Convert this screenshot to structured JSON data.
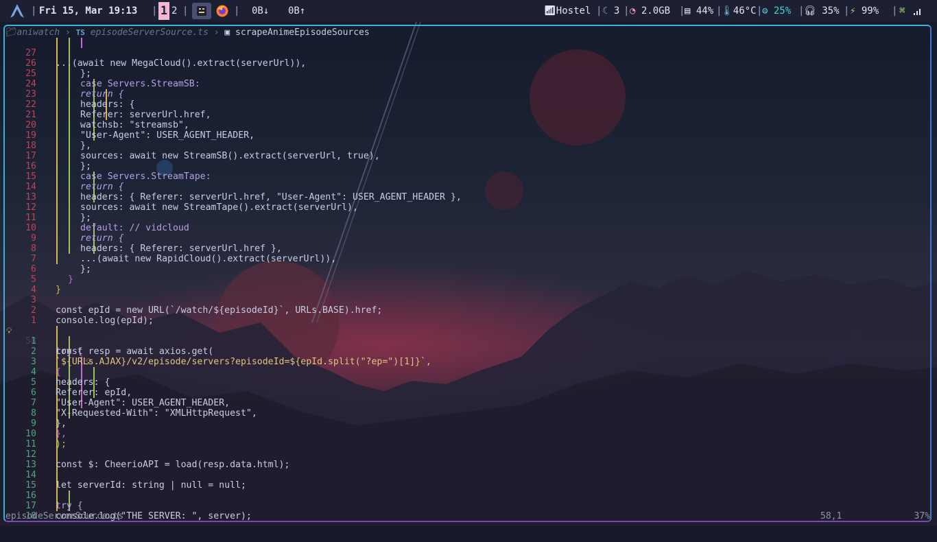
{
  "topbar": {
    "launcher_icon": "arch-logo-icon",
    "datetime": "Fri 15, Mar 19:13",
    "workspaces": [
      "1",
      "2"
    ],
    "active_workspace": "1",
    "apps": [
      "terminal-icon",
      "firefox-icon"
    ],
    "net_down": "0B↓",
    "net_up": "0B↑",
    "wifi_name": "Hostel",
    "moon_count": "3",
    "memory": "2.0GB",
    "disk": "44%",
    "temperature": "46°C",
    "cpu": "25%",
    "volume": "35%",
    "battery": "99%"
  },
  "editor": {
    "breadcrumb": {
      "folder": "aniwatch",
      "file_icon": "TS",
      "file": "episodeServerSource.ts",
      "symbol": "scrapeAnimeEpisodeSources"
    },
    "status": {
      "filename": "episodeServerSource.ts",
      "position": "58,1",
      "percent": "37%"
    },
    "line_numbers": [
      "27",
      "26",
      "25",
      "24",
      "23",
      "22",
      "21",
      "20",
      "19",
      "18",
      "17",
      "16",
      "15",
      "14",
      "13",
      "12",
      "11",
      "10",
      "9",
      "8",
      "7",
      "6",
      "5",
      "4",
      "3",
      "2",
      "1",
      "58",
      "1",
      "2",
      "3",
      "4",
      "5",
      "6",
      "7",
      "8",
      "9",
      "10",
      "11",
      "12",
      "13",
      "14",
      "15",
      "16",
      "17",
      "18"
    ],
    "code_lines": [
      "    ...(await new MegaCloud().extract(serverUrl)),",
      "  };",
      "case Servers.StreamSB:",
      "  return {",
      "    headers: {",
      "      Referer: serverUrl.href,",
      "      watchsb: \"streamsb\",",
      "      \"User-Agent\": USER_AGENT_HEADER,",
      "    },",
      "    sources: await new StreamSB().extract(serverUrl, true),",
      "  };",
      "case Servers.StreamTape:",
      "  return {",
      "    headers: { Referer: serverUrl.href, \"User-Agent\": USER_AGENT_HEADER },",
      "    sources: await new StreamTape().extract(serverUrl),",
      "  };",
      "default: // vidcloud",
      "  return {",
      "    headers: { Referer: serverUrl.href },",
      "    ...(await new RapidCloud().extract(serverUrl)),",
      "  };",
      "}",
      "}",
      "",
      "const epId = new URL(`/watch/${episodeId}`, URLs.BASE).href;",
      "console.log(epId);",
      "",
      "try {",
      "  const resp = await axios.get(",
      "    `${URLs.AJAX}/v2/episode/servers?episodeId=${epId.split(\"?ep=\")[1]}`,",
      "    {",
      "      headers: {",
      "        Referer: epId,",
      "        \"User-Agent\": USER_AGENT_HEADER,",
      "        \"X-Requested-With\": \"XMLHttpRequest\",",
      "      },",
      "    },",
      "  );",
      "",
      "  const $: CheerioAPI = load(resp.data.html);",
      "",
      "  let serverId: string | null = null;",
      "",
      "  try {",
      "    console.log(\"THE SERVER: \", server);",
      ""
    ]
  }
}
